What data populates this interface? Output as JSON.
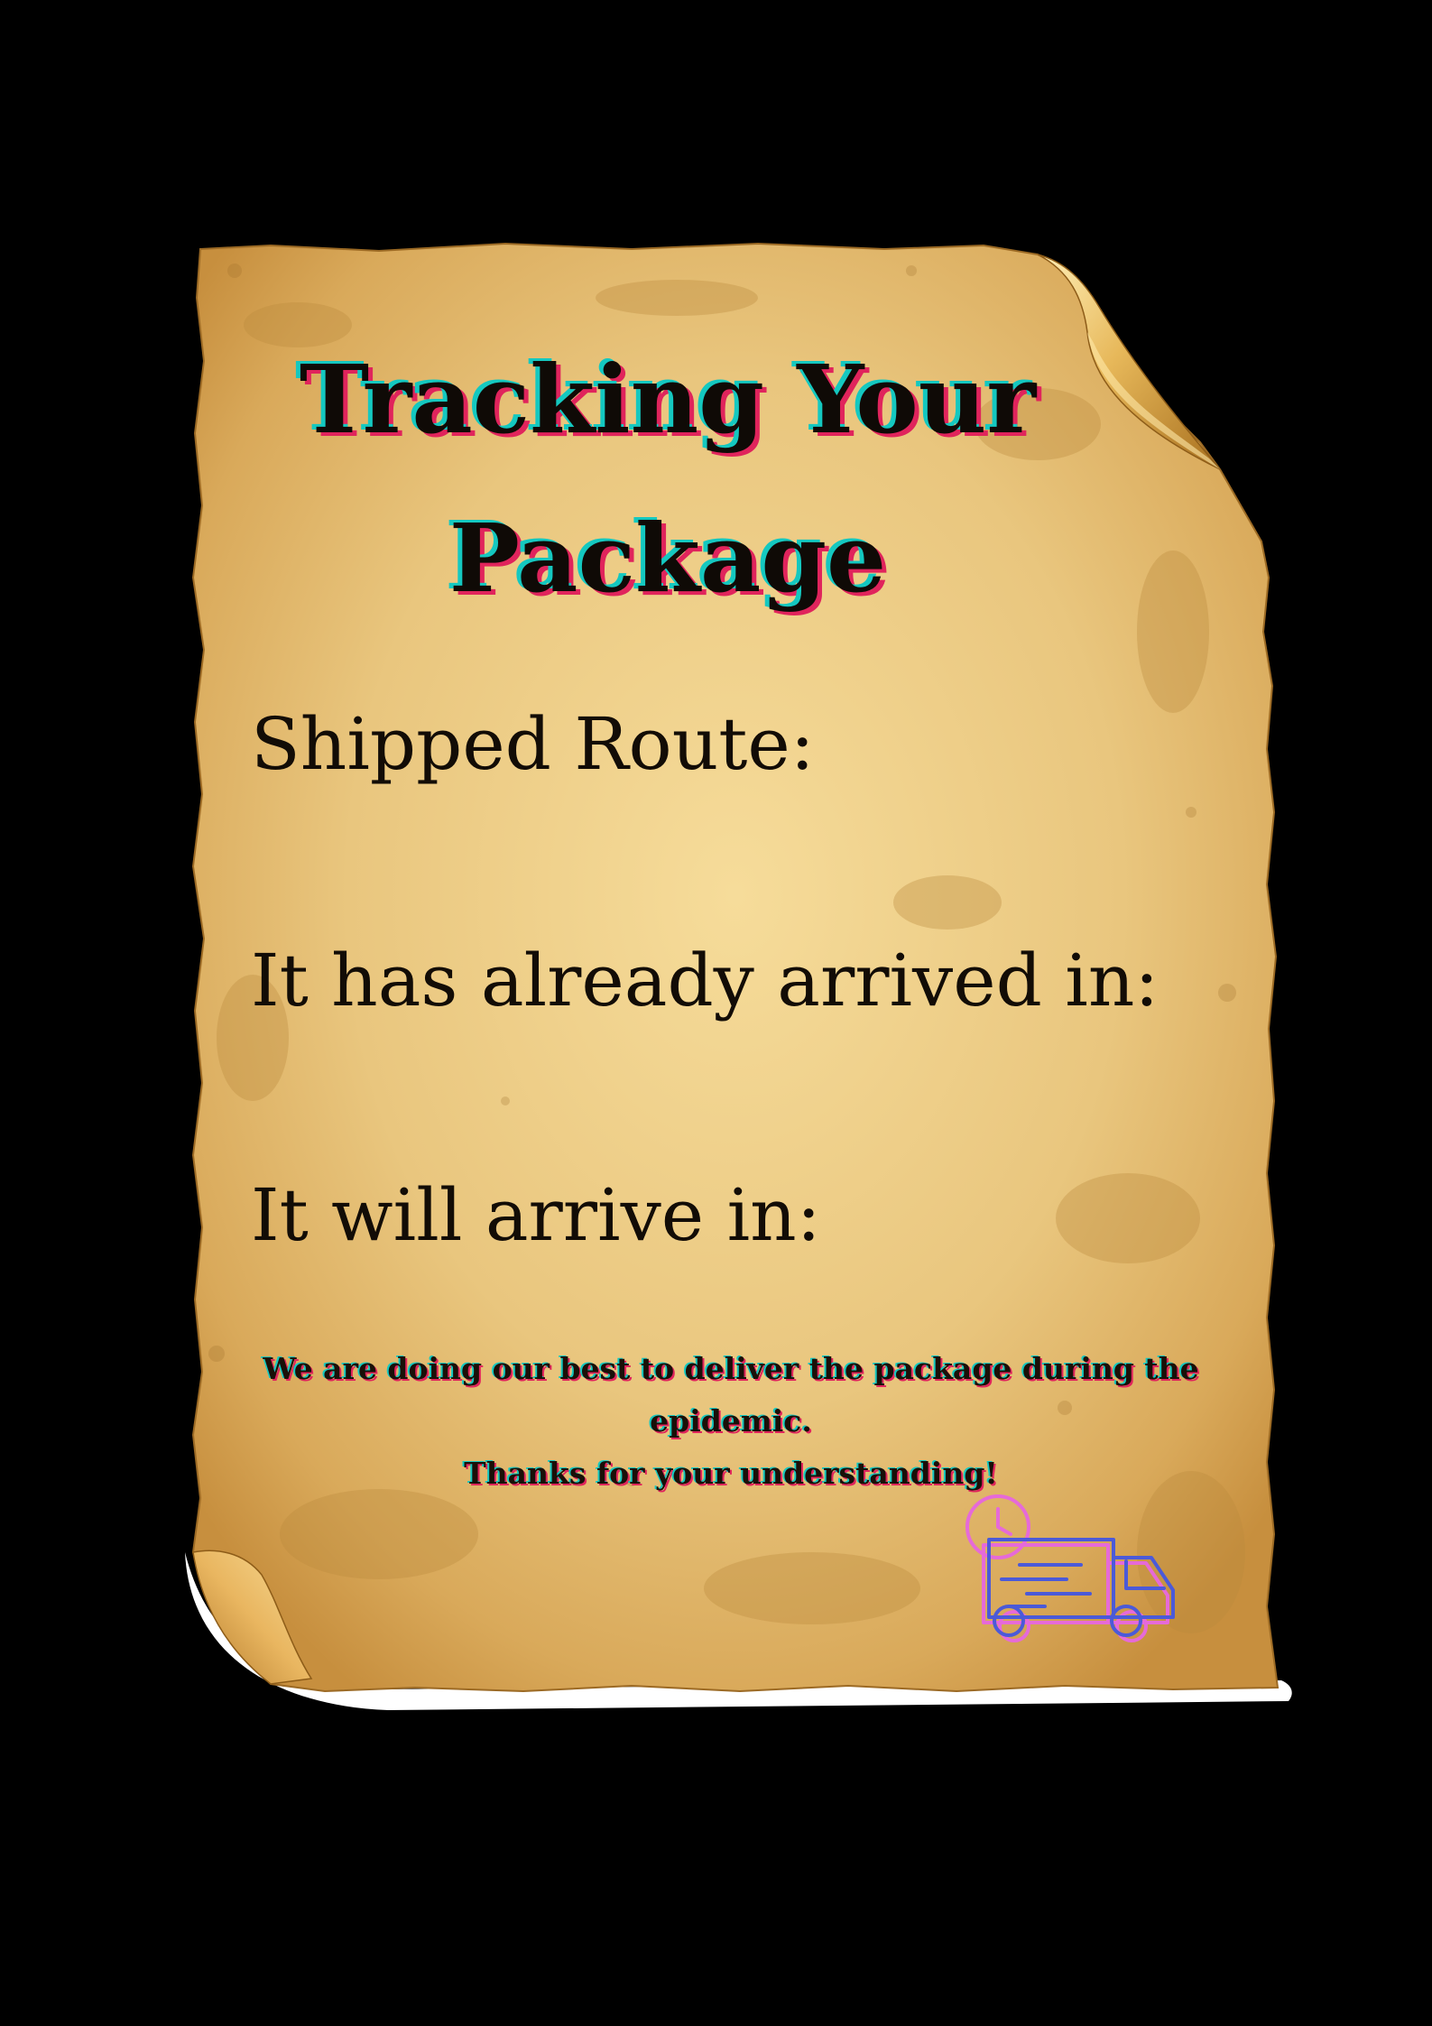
{
  "document": {
    "title_line1": "Tracking Your",
    "title_line2": "Package",
    "fields": {
      "shipped_route": "Shipped Route:",
      "arrived_in": "It has already arrived in:",
      "will_arrive": "It will arrive in:"
    },
    "note_line1": "We are doing our best to deliver the package during the epidemic.",
    "note_line2": "Thanks for your understanding!"
  },
  "icons": {
    "delivery": "delivery-truck-icon",
    "clock": "clock-icon"
  },
  "colors": {
    "background": "#000000",
    "paper": "#e8c47c",
    "text": "#120c06",
    "cyan_shadow": "#14c8c0",
    "red_shadow": "#e0245c",
    "truck_blue": "#4b5ad8",
    "truck_pink": "#e66ad8"
  }
}
